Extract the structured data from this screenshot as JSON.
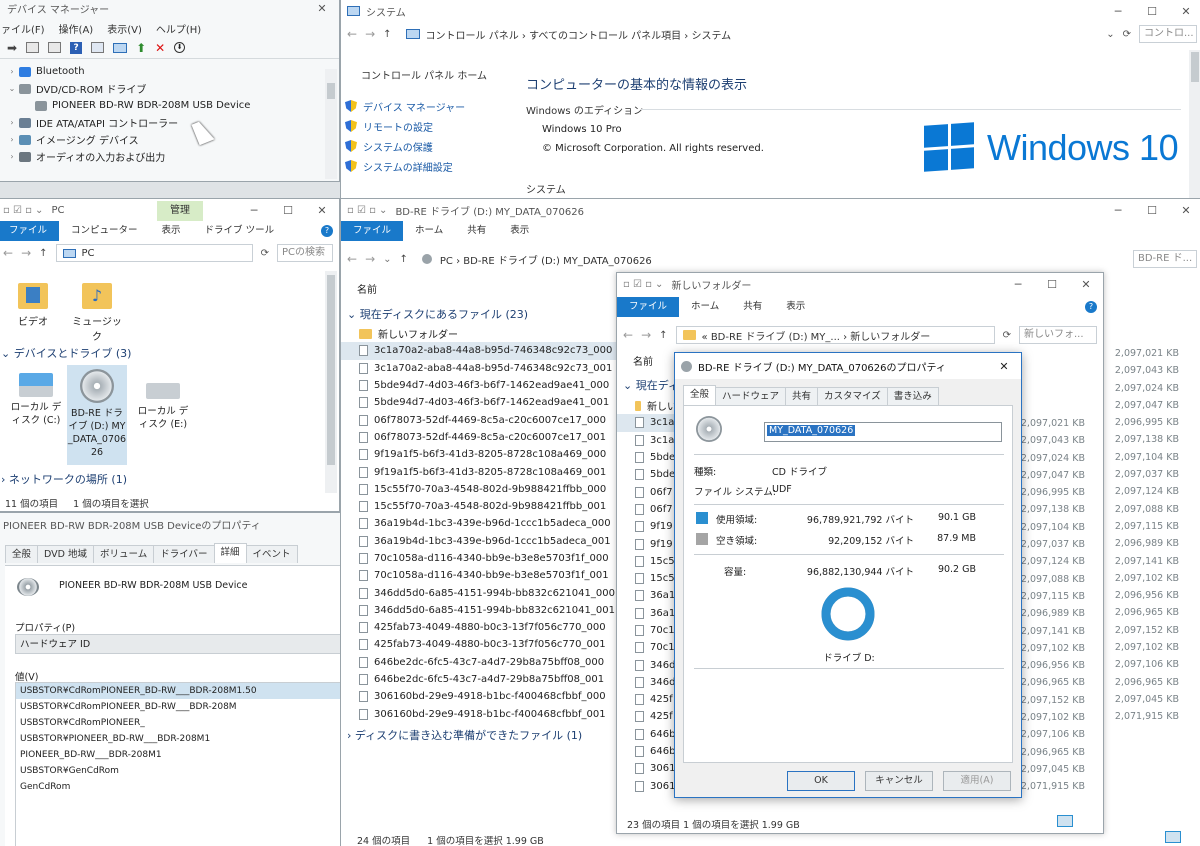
{
  "devmgr": {
    "title": "デバイス マネージャー",
    "menu": [
      "ァイル(F)",
      "操作(A)",
      "表示(V)",
      "ヘルプ(H)"
    ],
    "tree": [
      {
        "indent": 0,
        "exp": "›",
        "label": "Bluetooth",
        "color": "#2f7de1"
      },
      {
        "indent": 0,
        "exp": "⌄",
        "label": "DVD/CD-ROM ドライブ",
        "color": "#8a949b"
      },
      {
        "indent": 1,
        "exp": "",
        "label": "PIONEER BD-RW   BDR-208M USB Device",
        "color": "#8a949b"
      },
      {
        "indent": 0,
        "exp": "›",
        "label": "IDE ATA/ATAPI コントローラー",
        "color": "#6a7f94"
      },
      {
        "indent": 0,
        "exp": "›",
        "label": "イメージング デバイス",
        "color": "#5b8fb5"
      },
      {
        "indent": 0,
        "exp": "›",
        "label": "オーディオの入力および出力",
        "color": "#6c7780"
      }
    ]
  },
  "system": {
    "title": "システム",
    "breadcrumb": "コントロール パネル  ›  すべてのコントロール パネル項目  ›  システム",
    "search": "コントロ...",
    "home": "コントロール パネル ホーム",
    "links": [
      "デバイス マネージャー",
      "リモートの設定",
      "システムの保護",
      "システムの詳細設定"
    ],
    "heading": "コンピューターの基本的な情報の表示",
    "edition_label": "Windows のエディション",
    "edition": "Windows 10 Pro",
    "copyright": "© Microsoft Corporation. All rights reserved.",
    "section2": "システム",
    "logo_text": "Windows 10"
  },
  "pc": {
    "title": "PC",
    "manage_tab": "管理",
    "ribbon": [
      "ファイル",
      "コンピューター",
      "表示",
      "ドライブ ツール"
    ],
    "address": "PC",
    "search": "PCの検索",
    "folders": [
      "ビデオ",
      "ミュージック"
    ],
    "devices_header": "デバイスとドライブ (3)",
    "drives": [
      "ローカル ディスク (C:)",
      "BD-RE ドライブ (D:) MY_DATA_070626",
      "ローカル ディスク (E:)"
    ],
    "network_header": "ネットワークの場所 (1)",
    "status_items": "11 個の項目",
    "status_sel": "1 個の項目を選択"
  },
  "devprops": {
    "title": "PIONEER BD-RW   BDR-208M USB Deviceのプロパティ",
    "tabs": [
      "全般",
      "DVD 地域",
      "ボリューム",
      "ドライバー",
      "詳細",
      "イベント"
    ],
    "device_name": "PIONEER BD-RW   BDR-208M USB Device",
    "property_label": "プロパティ(P)",
    "property_value": "ハードウェア ID",
    "value_label": "値(V)",
    "values": [
      "USBSTOR¥CdRomPIONEER_BD-RW___BDR-208M1.50",
      "USBSTOR¥CdRomPIONEER_BD-RW___BDR-208M",
      "USBSTOR¥CdRomPIONEER_",
      "USBSTOR¥PIONEER_BD-RW___BDR-208M1",
      "PIONEER_BD-RW___BDR-208M1",
      "USBSTOR¥GenCdRom",
      "GenCdRom"
    ]
  },
  "bdwin": {
    "title": "BD-RE ドライブ (D:) MY_DATA_070626",
    "ribbon": [
      "ファイル",
      "ホーム",
      "共有",
      "表示"
    ],
    "address": "PC  ›  BD-RE ドライブ (D:) MY_DATA_070626",
    "search": "BD-RE ド...",
    "col_name": "名前",
    "col_size": "サイズ",
    "group1": "現在ディスクにあるファイル (23)",
    "folder": "新しいフォルダー",
    "files": [
      "3c1a70a2-aba8-44a8-b95d-746348c92c73_000",
      "3c1a70a2-aba8-44a8-b95d-746348c92c73_001",
      "5bde94d7-4d03-46f3-b6f7-1462ead9ae41_000",
      "5bde94d7-4d03-46f3-b6f7-1462ead9ae41_001",
      "06f78073-52df-4469-8c5a-c20c6007ce17_000",
      "06f78073-52df-4469-8c5a-c20c6007ce17_001",
      "9f19a1f5-b6f3-41d3-8205-8728c108a469_000",
      "9f19a1f5-b6f3-41d3-8205-8728c108a469_001",
      "15c55f70-70a3-4548-802d-9b988421ffbb_000",
      "15c55f70-70a3-4548-802d-9b988421ffbb_001",
      "36a19b4d-1bc3-439e-b96d-1ccc1b5adeca_000",
      "36a19b4d-1bc3-439e-b96d-1ccc1b5adeca_001",
      "70c1058a-d116-4340-bb9e-b3e8e5703f1f_000",
      "70c1058a-d116-4340-bb9e-b3e8e5703f1f_001",
      "346dd5d0-6a85-4151-994b-bb832c621041_000",
      "346dd5d0-6a85-4151-994b-bb832c621041_001",
      "425fab73-4049-4880-b0c3-13f7f056c770_000",
      "425fab73-4049-4880-b0c3-13f7f056c770_001",
      "646be2dc-6fc5-43c7-a4d7-29b8a75bff08_000",
      "646be2dc-6fc5-43c7-a4d7-29b8a75bff08_001",
      "306160bd-29e9-4918-b1bc-f400468cfbbf_000",
      "306160bd-29e9-4918-b1bc-f400468cfbbf_001"
    ],
    "sizes": [
      "2,097,021 KB",
      "2,097,043 KB",
      "2,097,024 KB",
      "2,097,047 KB",
      "2,096,995 KB",
      "2,097,138 KB",
      "2,097,104 KB",
      "2,097,037 KB",
      "2,097,124 KB",
      "2,097,088 KB",
      "2,097,115 KB",
      "2,096,989 KB",
      "2,097,141 KB",
      "2,097,102 KB",
      "2,096,956 KB",
      "2,096,965 KB",
      "2,097,152 KB",
      "2,097,102 KB",
      "2,097,106 KB",
      "2,096,965 KB",
      "2,097,045 KB",
      "2,071,915 KB"
    ],
    "group2": "ディスクに書き込む準備ができたファイル (1)",
    "status_items": "24 個の項目",
    "status_sel": "1 個の項目を選択  1.99 GB"
  },
  "newfolder": {
    "title": "新しいフォルダー",
    "ribbon": [
      "ファイル",
      "ホーム",
      "共有",
      "表示"
    ],
    "address": "«  BD-RE ドライブ (D:) MY_...  ›  新しいフォルダー",
    "search": "新しいフォ...",
    "col_name": "名前",
    "group": "現在ディ",
    "folder": "新しい",
    "file_prefixes": [
      "3c1a",
      "3c1a",
      "5bde",
      "5bde",
      "06f7",
      "06f7",
      "9f19",
      "9f19",
      "15c5",
      "15c5",
      "36a1",
      "36a1",
      "70c1",
      "70c1",
      "346d",
      "346d",
      "425f",
      "425f",
      "646b",
      "646b",
      "3061",
      "3061"
    ],
    "sizes": [
      "2,097,021 KB",
      "2,097,043 KB",
      "2,097,024 KB",
      "2,097,047 KB",
      "2,096,995 KB",
      "2,097,138 KB",
      "2,097,104 KB",
      "2,097,037 KB",
      "2,097,124 KB",
      "2,097,088 KB",
      "2,097,115 KB",
      "2,096,989 KB",
      "2,097,141 KB",
      "2,097,102 KB",
      "2,096,956 KB",
      "2,096,965 KB",
      "2,097,152 KB",
      "2,097,102 KB",
      "2,097,106 KB",
      "2,096,965 KB",
      "2,097,045 KB",
      "2,071,915 KB"
    ],
    "status": "23 個の項目    1 個の項目を選択  1.99 GB"
  },
  "dialog": {
    "title": "BD-RE ドライブ (D:) MY_DATA_070626のプロパティ",
    "tabs": [
      "全般",
      "ハードウェア",
      "共有",
      "カスタマイズ",
      "書き込み"
    ],
    "volume_name": "MY_DATA_070626",
    "type_label": "種類:",
    "type_value": "CD ドライブ",
    "fs_label": "ファイル システム:",
    "fs_value": "UDF",
    "used_label": "使用領域:",
    "used_bytes": "96,789,921,792 バイト",
    "used_h": "90.1 GB",
    "free_label": "空き領域:",
    "free_bytes": "92,209,152 バイト",
    "free_h": "87.9 MB",
    "cap_label": "容量:",
    "cap_bytes": "96,882,130,944 バイト",
    "cap_h": "90.2 GB",
    "drive_label": "ドライブ D:",
    "used_fraction": 0.999,
    "used_color": "#2a8fd0",
    "free_color": "#a5a5a5",
    "ok": "OK",
    "cancel": "キャンセル",
    "apply": "適用(A)"
  }
}
